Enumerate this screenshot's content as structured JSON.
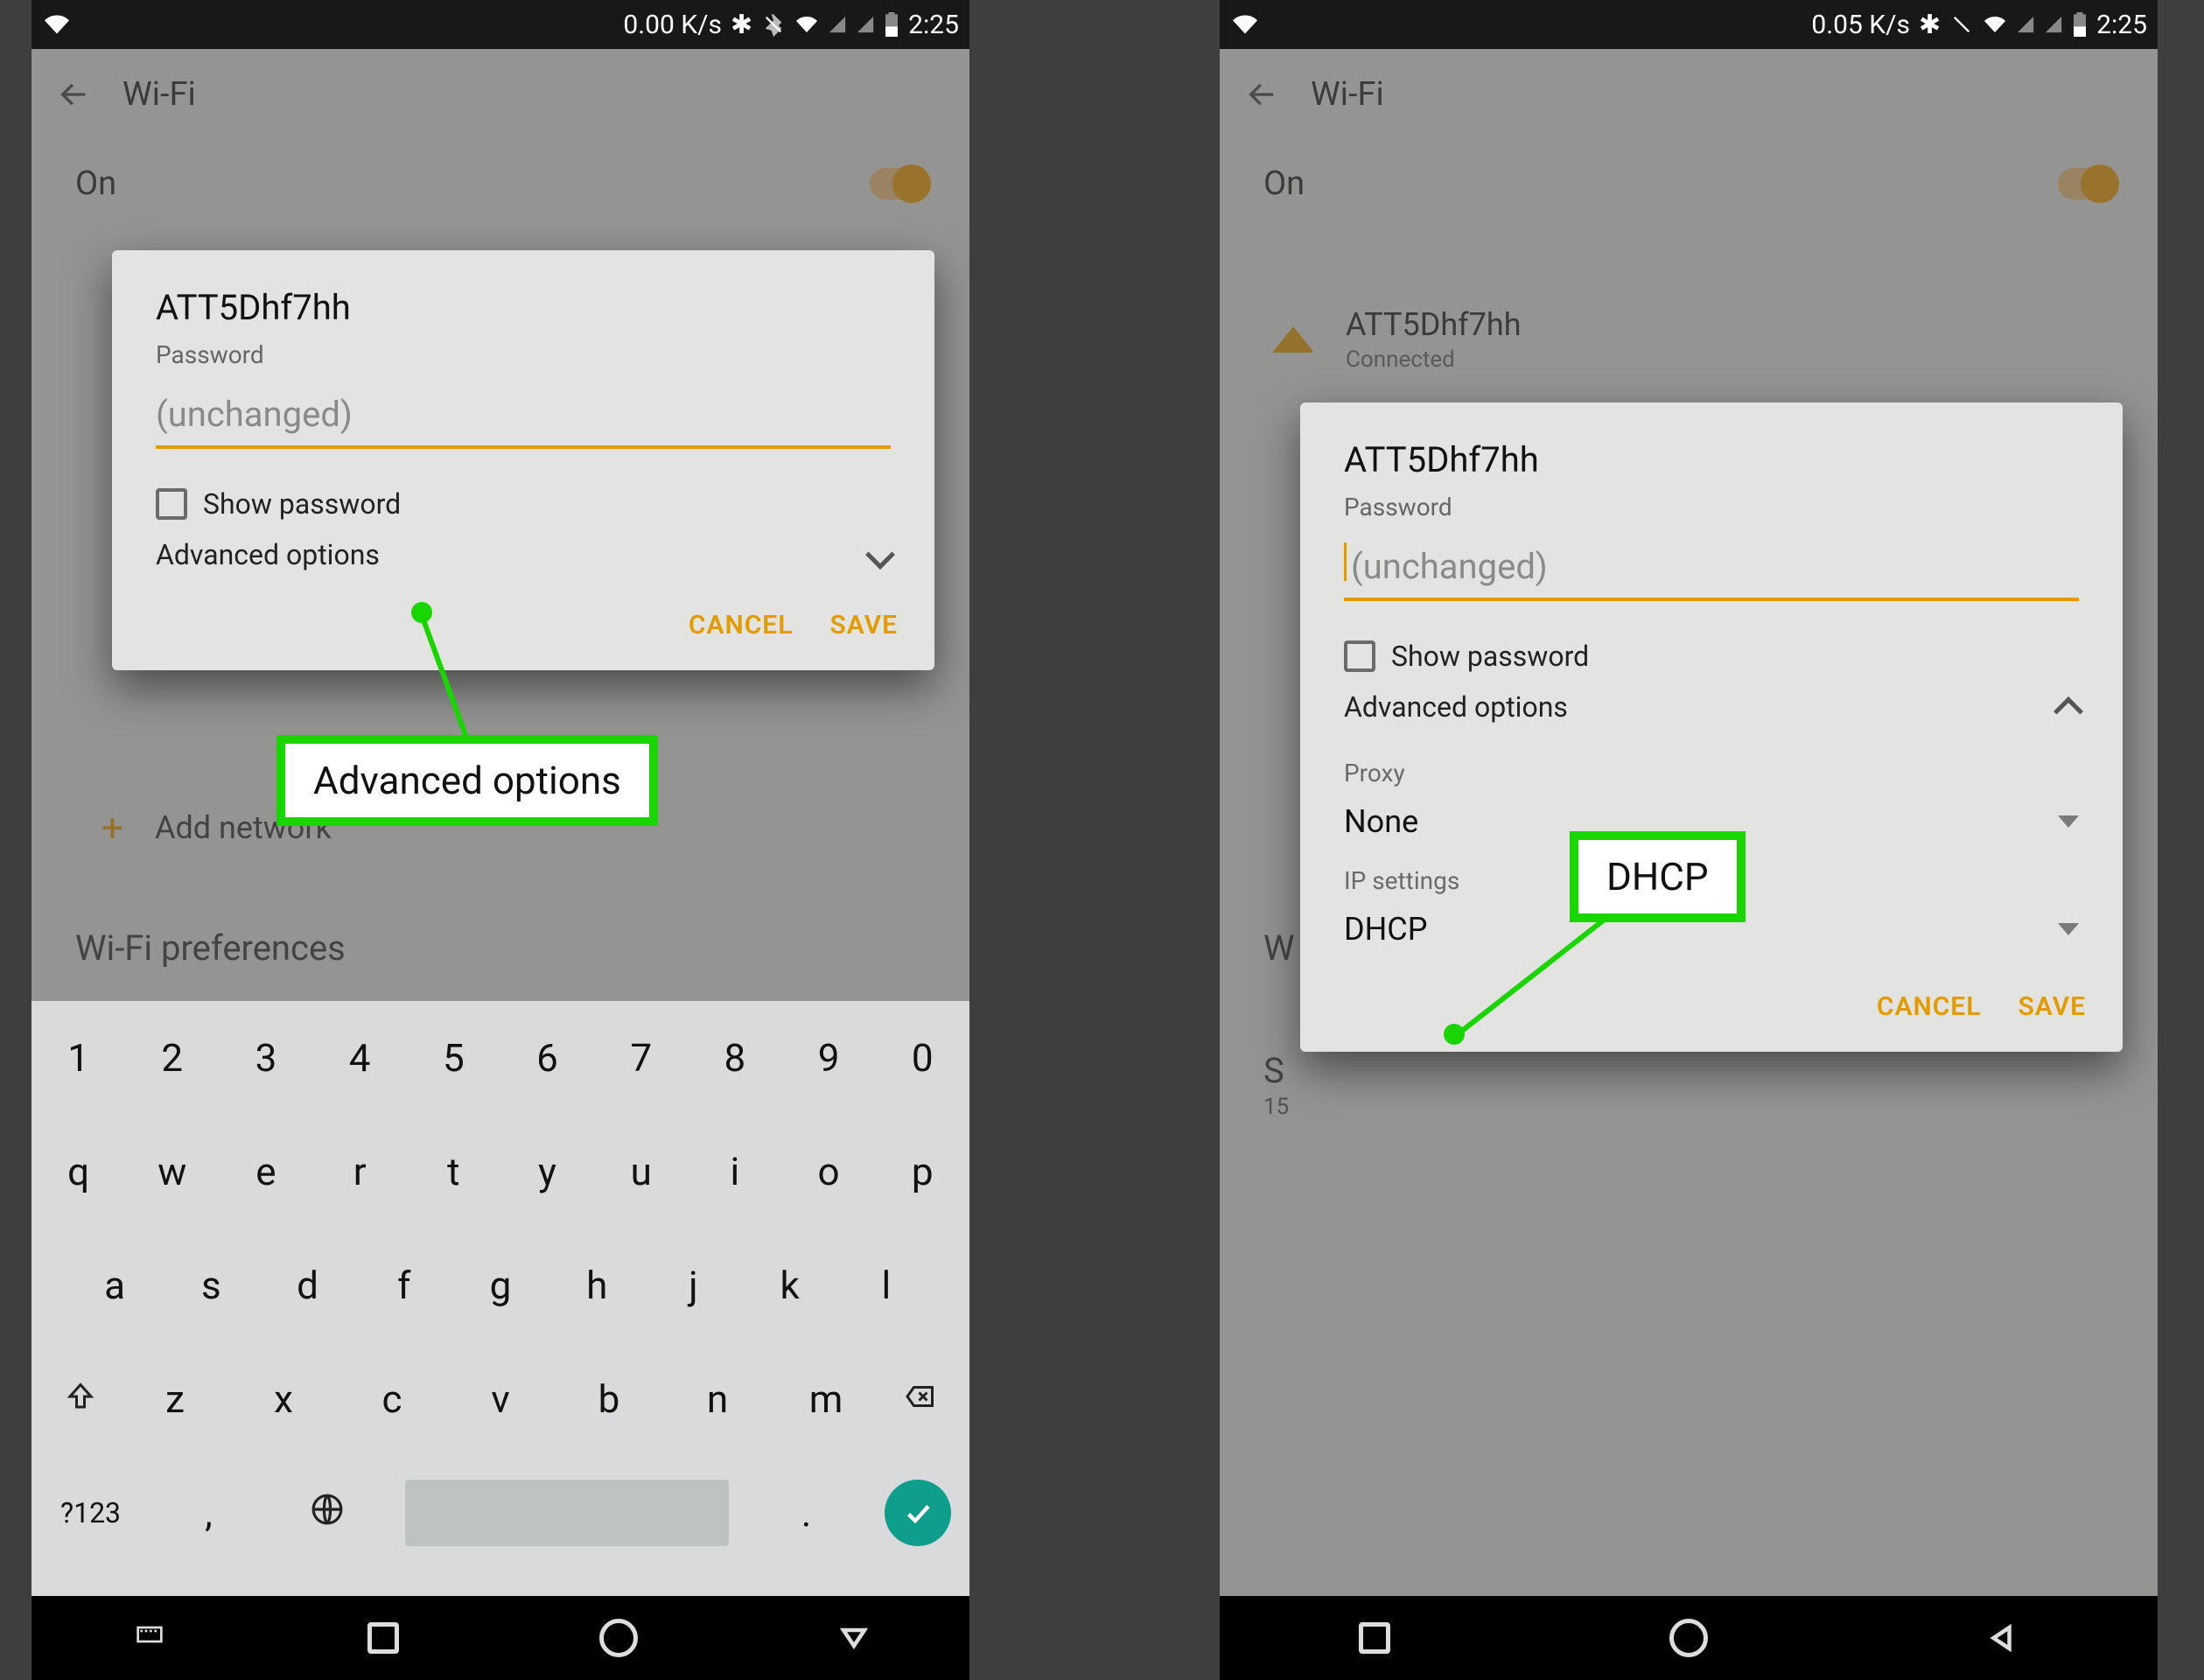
{
  "left": {
    "statusbar": {
      "speed": "0.00 K/s",
      "time": "2:25"
    },
    "appbar_title": "Wi-Fi",
    "on_label": "On",
    "dialog": {
      "ssid": "ATT5Dhf7hh",
      "password_label": "Password",
      "password_placeholder": "(unchanged)",
      "show_password": "Show password",
      "advanced": "Advanced options",
      "cancel": "CANCEL",
      "save": "SAVE"
    },
    "add_network": "Add network",
    "wifi_prefs": "Wi-Fi preferences",
    "callout": "Advanced options",
    "keyboard": {
      "row1": [
        "1",
        "2",
        "3",
        "4",
        "5",
        "6",
        "7",
        "8",
        "9",
        "0"
      ],
      "row2": [
        "q",
        "w",
        "e",
        "r",
        "t",
        "y",
        "u",
        "i",
        "o",
        "p"
      ],
      "row3": [
        "a",
        "s",
        "d",
        "f",
        "g",
        "h",
        "j",
        "k",
        "l"
      ],
      "row4": [
        "z",
        "x",
        "c",
        "v",
        "b",
        "n",
        "m"
      ],
      "sym": "?123",
      "comma": ",",
      "period": "."
    }
  },
  "right": {
    "statusbar": {
      "speed": "0.05 K/s",
      "time": "2:25"
    },
    "appbar_title": "Wi-Fi",
    "on_label": "On",
    "net_ssid": "ATT5Dhf7hh",
    "net_status": "Connected",
    "dialog": {
      "ssid": "ATT5Dhf7hh",
      "password_label": "Password",
      "password_placeholder": "(unchanged)",
      "show_password": "Show password",
      "advanced": "Advanced options",
      "proxy_label": "Proxy",
      "proxy_value": "None",
      "ip_label": "IP settings",
      "ip_value": "DHCP",
      "cancel": "CANCEL",
      "save": "SAVE"
    },
    "bg_pref_initial": "W",
    "bg_saved_initial": "S",
    "bg_saved_sub": "15",
    "callout": "DHCP"
  }
}
